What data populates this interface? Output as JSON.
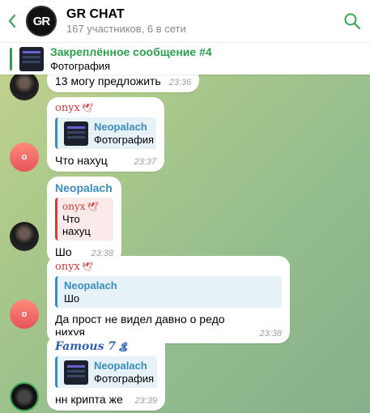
{
  "header": {
    "back_icon": "chevron-left-icon",
    "avatar_text": "GR",
    "title": "GR CHAT",
    "subtitle": "167 участников, 6 в сети",
    "search_icon": "search-icon"
  },
  "pinned": {
    "title": "Закреплённое сообщение #4",
    "subtitle": "Фотография"
  },
  "messages": [
    {
      "text": "13 могу предложить",
      "time": "23:36"
    },
    {
      "sender": "onyx",
      "sender_emoji": "🕊",
      "reply_name": "Neopalach",
      "reply_text": "Фотография",
      "avatar_letter": "o",
      "text": "Что нахуц",
      "time": "23:37"
    },
    {
      "sender": "Neopalach",
      "reply_name": "onyx",
      "reply_emoji": "🕊",
      "reply_text": "Что нахуц",
      "text": "Шо",
      "time": "23:38"
    },
    {
      "sender": "onyx",
      "sender_emoji": "🕊",
      "reply_name": "Neopalach",
      "reply_text": "Шо",
      "avatar_letter": "o",
      "text": "Да прост не видел давно о редо нихуя",
      "time": "23:38"
    },
    {
      "sender": "Famous 7",
      "sender_emoji": "🏝",
      "reply_name": "Neopalach",
      "reply_text": "Фотография",
      "text": "нн крипта же",
      "time": "23:39"
    }
  ],
  "colors": {
    "pin_accent": "#2aa14b",
    "link_blue": "#3a8cbf",
    "onyx_red": "#d43b3b"
  }
}
